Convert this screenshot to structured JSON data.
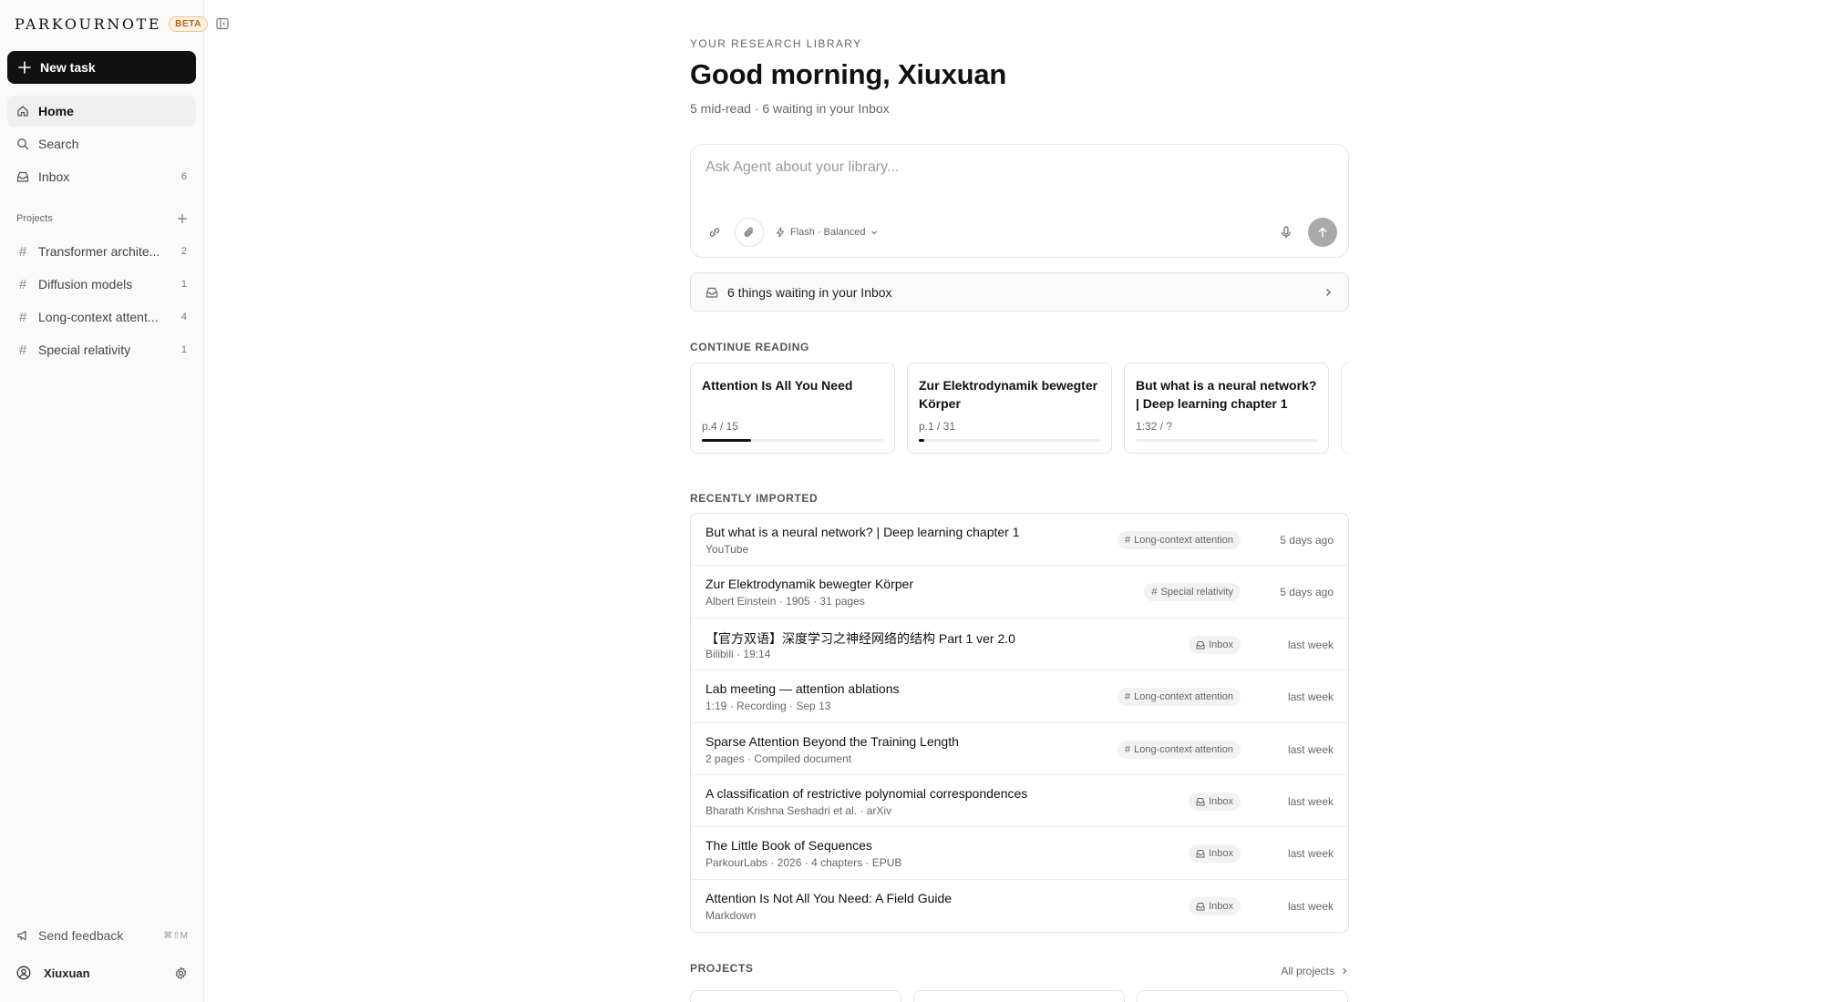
{
  "brand": {
    "name": "PARKOURNOTE",
    "badge": "BETA"
  },
  "sidebar": {
    "new_task": "New task",
    "nav": [
      {
        "label": "Home",
        "icon": "home-icon"
      },
      {
        "label": "Search",
        "icon": "search-icon"
      },
      {
        "label": "Inbox",
        "icon": "inbox-icon",
        "count": "6"
      }
    ],
    "projects_label": "Projects",
    "projects": [
      {
        "label": "Transformer archite...",
        "count": "2"
      },
      {
        "label": "Diffusion models",
        "count": "1"
      },
      {
        "label": "Long-context attent...",
        "count": "4"
      },
      {
        "label": "Special relativity",
        "count": "1"
      }
    ],
    "feedback": {
      "label": "Send feedback",
      "shortcut": "⌘⇧M"
    },
    "user": {
      "name": "Xiuxuan"
    }
  },
  "main": {
    "eyebrow": "YOUR RESEARCH LIBRARY",
    "greeting": "Good morning, Xiuxuan",
    "subtitle": "5 mid-read · 6 waiting in your Inbox",
    "ask": {
      "placeholder": "Ask Agent about your library...",
      "model": "Flash · Balanced"
    },
    "inbox_bar": "6 things waiting in your Inbox",
    "continue_label": "CONTINUE READING",
    "continue": [
      {
        "title": "Attention Is All You Need",
        "progress_text": "p.4 / 15",
        "progress": 0.27
      },
      {
        "title": "Zur Elektrodynamik bewegter Körper",
        "progress_text": "p.1 / 31",
        "progress": 0.03
      },
      {
        "title": "But what is a neural network? | Deep learning chapter 1",
        "progress_text": "1:32 / ?",
        "progress": 0
      }
    ],
    "recent_label": "RECENTLY IMPORTED",
    "recent": [
      {
        "title": "But what is a neural network? | Deep learning chapter 1",
        "meta": "YouTube",
        "tag": "Long-context attention",
        "tag_kind": "project",
        "time": "5 days ago"
      },
      {
        "title": "Zur Elektrodynamik bewegter Körper",
        "meta": "Albert Einstein · 1905 · 31 pages",
        "tag": "Special relativity",
        "tag_kind": "project",
        "time": "5 days ago"
      },
      {
        "title": "【官方双语】深度学习之神经网络的结构 Part 1 ver 2.0",
        "meta": "Bilibili · 19:14",
        "tag": "Inbox",
        "tag_kind": "inbox",
        "time": "last week"
      },
      {
        "title": "Lab meeting — attention ablations",
        "meta": "1:19 · Recording · Sep 13",
        "tag": "Long-context attention",
        "tag_kind": "project",
        "time": "last week"
      },
      {
        "title": "Sparse Attention Beyond the Training Length",
        "meta": "2 pages · Compiled document",
        "tag": "Long-context attention",
        "tag_kind": "project",
        "time": "last week"
      },
      {
        "title": "A classification of restrictive polynomial correspondences",
        "meta": "Bharath Krishna Seshadri et al. · arXiv",
        "tag": "Inbox",
        "tag_kind": "inbox",
        "time": "last week"
      },
      {
        "title": "The Little Book of Sequences",
        "meta": "ParkourLabs · 2026 · 4 chapters · EPUB",
        "tag": "Inbox",
        "tag_kind": "inbox",
        "time": "last week"
      },
      {
        "title": "Attention Is Not All You Need: A Field Guide",
        "meta": "Markdown",
        "tag": "Inbox",
        "tag_kind": "inbox",
        "time": "last week"
      }
    ],
    "projects_label": "PROJECTS",
    "all_projects": "All projects"
  }
}
